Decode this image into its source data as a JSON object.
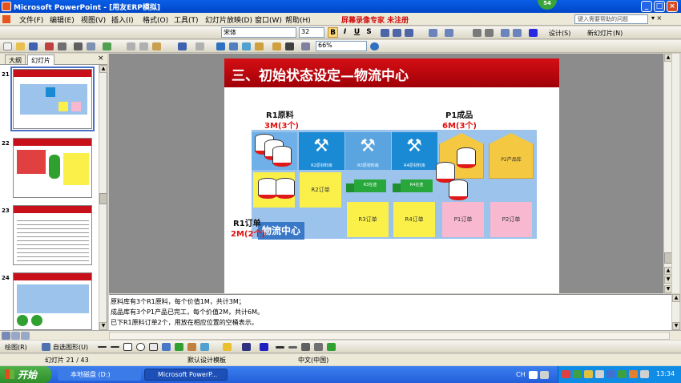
{
  "window": {
    "title": "Microsoft PowerPoint - [用友ERP模拟]",
    "badge": "54",
    "min_label": "_",
    "max_label": "□",
    "close_label": "×"
  },
  "menu": {
    "items": [
      "文件(F)",
      "编辑(E)",
      "视图(V)",
      "插入(I)",
      "格式(O)",
      "工具(T)",
      "幻灯片放映(D)",
      "窗口(W)",
      "帮助(H)"
    ],
    "promo": "屏幕录像专家 未注册",
    "help_placeholder": "键入需要帮助的问题"
  },
  "format_toolbar": {
    "font": "宋体",
    "size": "32",
    "bold": "B",
    "italic": "I",
    "underline": "U",
    "shadow": "S",
    "design": "设计(S)",
    "new_slide": "新幻灯片(N)"
  },
  "std_toolbar": {
    "zoom": "66%"
  },
  "left_panel": {
    "tab_outline": "大纲",
    "tab_slides": "幻灯片",
    "close": "×",
    "slide_numbers": [
      "21",
      "22",
      "23",
      "24"
    ]
  },
  "slide": {
    "title": "三、初始状态设定—物流中心",
    "r1_label": "R1原料",
    "r1_value": "3M(3个)",
    "p1_label": "P1成品",
    "p1_value": "6M(3个)",
    "r1_order_label": "R1订单",
    "r1_order_value": "2M(2个)",
    "center": "物流中心",
    "r2_material": "R2原材料库",
    "r3_material": "R3原材料库",
    "r4_material": "R4原材料库",
    "p2_warehouse": "P2产品库",
    "r3_transit": "R3在途",
    "r4_transit": "R4在途",
    "r2_order": "R2订单",
    "r3_order": "R3订单",
    "r4_order": "R4订单",
    "p1_order": "P1订单",
    "p2_order": "P2订单"
  },
  "notes": {
    "lines": [
      "原料库有3个R1原料，每个价值1M，共计3M；",
      "成品库有3个P1产品已完工，每个价值2M，共计6M。",
      "已下R1原料订单2个，用放在相应位置的空桶表示。"
    ]
  },
  "drawing_toolbar": {
    "draw": "绘图(R)",
    "autoshapes": "自选图形(U)"
  },
  "status": {
    "slide": "幻灯片 21 / 43",
    "template": "默认设计模板",
    "language": "中文(中国)"
  },
  "taskbar": {
    "start": "开始",
    "item1": "本地磁盘 (D:)",
    "item2": "Microsoft PowerP...",
    "lang": "CH",
    "time": "13:34"
  },
  "colors": {
    "title_red": "#c8101a",
    "board_blue": "#9cc3ec",
    "accent_red": "#e01010"
  }
}
